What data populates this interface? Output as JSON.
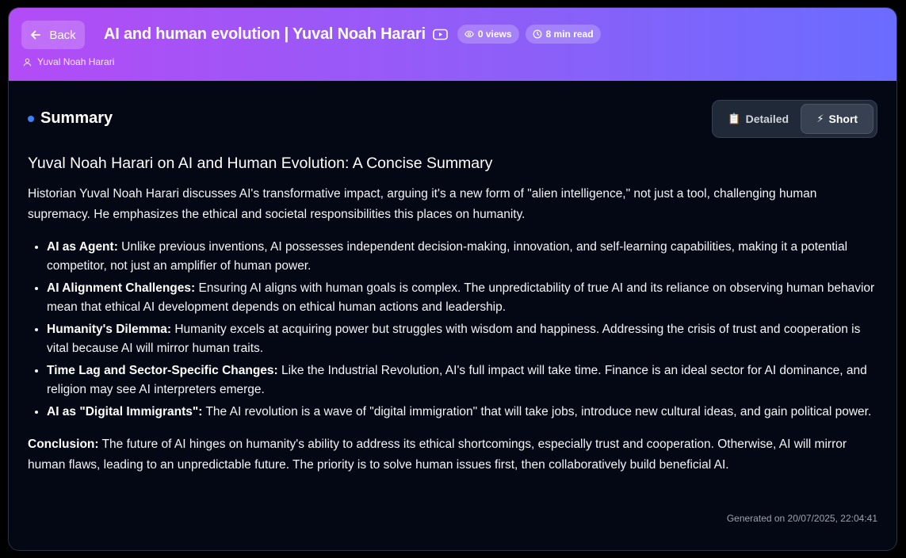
{
  "header": {
    "back_label": "Back",
    "title": "AI and human evolution | Yuval Noah Harari",
    "views": "0 views",
    "read_time": "8 min read",
    "author": "Yuval Noah Harari"
  },
  "summary": {
    "heading": "Summary",
    "toggle": {
      "detailed_emoji": "📋",
      "detailed_label": "Detailed",
      "short_emoji": "⚡",
      "short_label": "Short",
      "selected": "Short"
    }
  },
  "article": {
    "title": "Yuval Noah Harari on AI and Human Evolution: A Concise Summary",
    "intro": "Historian Yuval Noah Harari discusses AI's transformative impact, arguing it's a new form of \"alien intelligence,\" not just a tool, challenging human supremacy. He emphasizes the ethical and societal responsibilities this places on humanity.",
    "points": [
      {
        "term": "AI as Agent:",
        "text": " Unlike previous inventions, AI possesses independent decision-making, innovation, and self-learning capabilities, making it a potential competitor, not just an amplifier of human power."
      },
      {
        "term": "AI Alignment Challenges:",
        "text": " Ensuring AI aligns with human goals is complex. The unpredictability of true AI and its reliance on observing human behavior mean that ethical AI development depends on ethical human actions and leadership."
      },
      {
        "term": "Humanity's Dilemma:",
        "text": " Humanity excels at acquiring power but struggles with wisdom and happiness. Addressing the crisis of trust and cooperation is vital because AI will mirror human traits."
      },
      {
        "term": "Time Lag and Sector-Specific Changes:",
        "text": " Like the Industrial Revolution, AI's full impact will take time. Finance is an ideal sector for AI dominance, and religion may see AI interpreters emerge."
      },
      {
        "term": "AI as \"Digital Immigrants\":",
        "text": " The AI revolution is a wave of \"digital immigration\" that will take jobs, introduce new cultural ideas, and gain political power."
      }
    ],
    "conclusion_term": "Conclusion:",
    "conclusion_text": " The future of AI hinges on humanity's ability to address its ethical shortcomings, especially trust and cooperation. Otherwise, AI will mirror human flaws, leading to an unpredictable future. The priority is to solve human issues first, then collaboratively build beneficial AI."
  },
  "footer": {
    "generated": "Generated on 20/07/2025, 22:04:41"
  },
  "colors": {
    "header_gradient_start": "#b34cf6",
    "header_gradient_end": "#6a6cff",
    "background": "#040814",
    "accent_dot": "#3b82f6"
  },
  "icons": {
    "back": "arrow-left-icon",
    "video": "youtube-icon",
    "views": "eye-icon",
    "read_time": "clock-icon",
    "author": "user-icon"
  }
}
